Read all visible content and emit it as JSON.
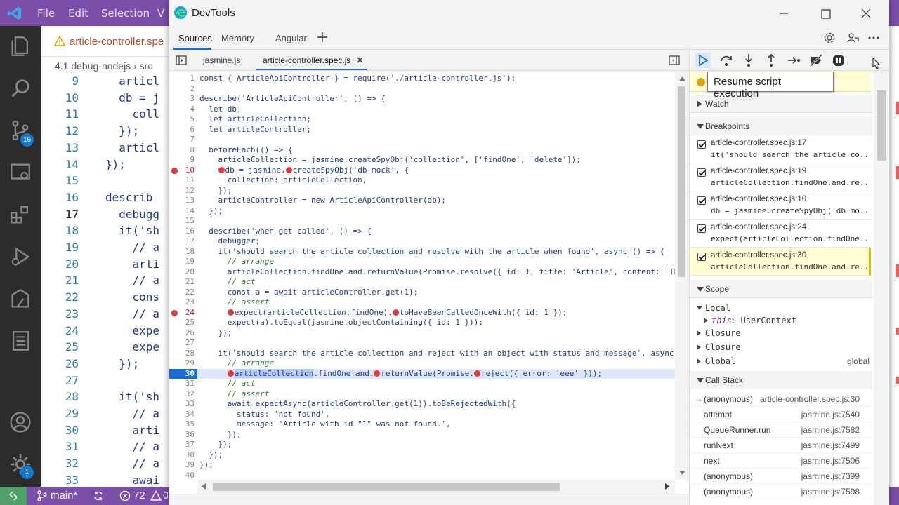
{
  "vscode": {
    "menu": [
      "File",
      "Edit",
      "Selection",
      "V"
    ],
    "tab_title": "article-controller.spe",
    "breadcrumb": "4.1.debug-nodejs  ›  src",
    "source_control_badge": "16",
    "accounts_badge": "1",
    "lines": [
      {
        "n": "9",
        "code": "  articl"
      },
      {
        "n": "10",
        "code": "  db = j"
      },
      {
        "n": "11",
        "code": "    coll"
      },
      {
        "n": "12",
        "code": "  });"
      },
      {
        "n": "13",
        "code": "  articl"
      },
      {
        "n": "14",
        "code": "});"
      },
      {
        "n": "15",
        "code": ""
      },
      {
        "n": "16",
        "code": "describ"
      },
      {
        "n": "17",
        "code": "  debugg"
      },
      {
        "n": "18",
        "code": "  it('sh"
      },
      {
        "n": "19",
        "code": "    // a"
      },
      {
        "n": "20",
        "code": "    arti"
      },
      {
        "n": "21",
        "code": "    // a"
      },
      {
        "n": "22",
        "code": "    cons"
      },
      {
        "n": "23",
        "code": "    // a"
      },
      {
        "n": "24",
        "code": "    expe"
      },
      {
        "n": "25",
        "code": "    expe"
      },
      {
        "n": "26",
        "code": "  });"
      },
      {
        "n": "27",
        "code": ""
      },
      {
        "n": "28",
        "code": "  it('sh"
      },
      {
        "n": "29",
        "code": "    // a"
      },
      {
        "n": "30",
        "code": "    arti"
      },
      {
        "n": "31",
        "code": "    // a"
      },
      {
        "n": "32",
        "code": "    // a"
      },
      {
        "n": "33",
        "code": "    awai"
      }
    ],
    "status": {
      "branch": "main*",
      "errors": "72",
      "warnings": "0"
    }
  },
  "devtools": {
    "title": "DevTools",
    "panel_tabs": [
      "Sources",
      "Memory",
      "Angular"
    ],
    "file_tabs": [
      "jasmine.js",
      "article-controller.spec.js"
    ],
    "code_lines": [
      {
        "n": "1",
        "t": "const { ArticleApiController } = require('./article-controller.js');"
      },
      {
        "n": "2",
        "t": ""
      },
      {
        "n": "3",
        "t": "describe('ArticleApiController', () => {"
      },
      {
        "n": "4",
        "t": "  let db;"
      },
      {
        "n": "5",
        "t": "  let articleCollection;"
      },
      {
        "n": "6",
        "t": "  let articleController;"
      },
      {
        "n": "7",
        "t": ""
      },
      {
        "n": "8",
        "t": "  beforeEach(() => {"
      },
      {
        "n": "9",
        "t": "    articleCollection = jasmine.createSpyObj('collection', ['findOne', 'delete']);"
      },
      {
        "n": "10",
        "t": "    ●db = jasmine.●createSpyObj('db mock', {",
        "bp": true
      },
      {
        "n": "11",
        "t": "      collection: articleCollection,"
      },
      {
        "n": "12",
        "t": "    });"
      },
      {
        "n": "13",
        "t": "    articleController = new ArticleApiController(db);"
      },
      {
        "n": "14",
        "t": "  });"
      },
      {
        "n": "15",
        "t": ""
      },
      {
        "n": "16",
        "t": "  describe('when get called', () => {"
      },
      {
        "n": "17",
        "t": "    debugger;"
      },
      {
        "n": "18",
        "t": "    it('should search the article collection and resolve with the article when found', async () => {"
      },
      {
        "n": "19",
        "t": "      // arrange"
      },
      {
        "n": "20",
        "t": "      articleCollection.findOne.and.returnValue(Promise.resolve({ id: 1, title: 'Article', content: 'Th"
      },
      {
        "n": "21",
        "t": "      // act"
      },
      {
        "n": "22",
        "t": "      const a = await articleController.get(1);"
      },
      {
        "n": "23",
        "t": "      // assert"
      },
      {
        "n": "24",
        "t": "      ●expect(articleCollection.findOne).●toHaveBeenCalledOnceWith({ id: 1 });",
        "bp": true
      },
      {
        "n": "25",
        "t": "      expect(a).toEqual(jasmine.objectContaining({ id: 1 }));"
      },
      {
        "n": "26",
        "t": "    });"
      },
      {
        "n": "27",
        "t": ""
      },
      {
        "n": "28",
        "t": "    it('should search the article collection and reject with an object with status and message', async"
      },
      {
        "n": "29",
        "t": "      // arrange"
      },
      {
        "n": "30",
        "t": "      ●articleCollection.findOne.and.●returnValue(Promise.●reject({ error: 'eee' }));",
        "bp": true,
        "current": true
      },
      {
        "n": "31",
        "t": "      // act"
      },
      {
        "n": "32",
        "t": "      // assert"
      },
      {
        "n": "33",
        "t": "      await expectAsync(articleController.get(1)).toBeRejectedWith({"
      },
      {
        "n": "34",
        "t": "        status: 'not found',"
      },
      {
        "n": "35",
        "t": "        message: 'Article with id \"1\" was not found.',"
      },
      {
        "n": "36",
        "t": "      });"
      },
      {
        "n": "37",
        "t": "    });"
      },
      {
        "n": "38",
        "t": "  });"
      },
      {
        "n": "39",
        "t": "});"
      },
      {
        "n": "40",
        "t": ""
      }
    ],
    "tooltip": "Resume script execution",
    "sections": {
      "watch": "Watch",
      "breakpoints": "Breakpoints",
      "scope": "Scope",
      "call_stack": "Call Stack"
    },
    "breakpoints": [
      {
        "file": "article-controller.spec.js:17",
        "code": "it('should search the article co..."
      },
      {
        "file": "article-controller.spec.js:19",
        "code": "articleCollection.findOne.and.re..."
      },
      {
        "file": "article-controller.spec.js:10",
        "code": "db = jasmine.createSpyObj('db mo..."
      },
      {
        "file": "article-controller.spec.js:24",
        "code": "expect(articleCollection.findOne..."
      },
      {
        "file": "article-controller.spec.js:30",
        "code": "articleCollection.findOne.and.re..."
      }
    ],
    "scope": {
      "local": "Local",
      "this_key": "this",
      "this_val": ": UserContext",
      "closure1": "Closure",
      "closure2": "Closure",
      "global": "Global",
      "global_val": "global"
    },
    "call_stack": [
      {
        "fn": "(anonymous)",
        "loc": "article-controller.spec.js:30"
      },
      {
        "fn": "attempt",
        "loc": "jasmine.js:7540"
      },
      {
        "fn": "QueueRunner.run",
        "loc": "jasmine.js:7582"
      },
      {
        "fn": "runNext",
        "loc": "jasmine.js:7499"
      },
      {
        "fn": "next",
        "loc": "jasmine.js:7506"
      },
      {
        "fn": "(anonymous)",
        "loc": "jasmine.js:7399"
      },
      {
        "fn": "(anonymous)",
        "loc": "jasmine.js:7598"
      }
    ]
  }
}
